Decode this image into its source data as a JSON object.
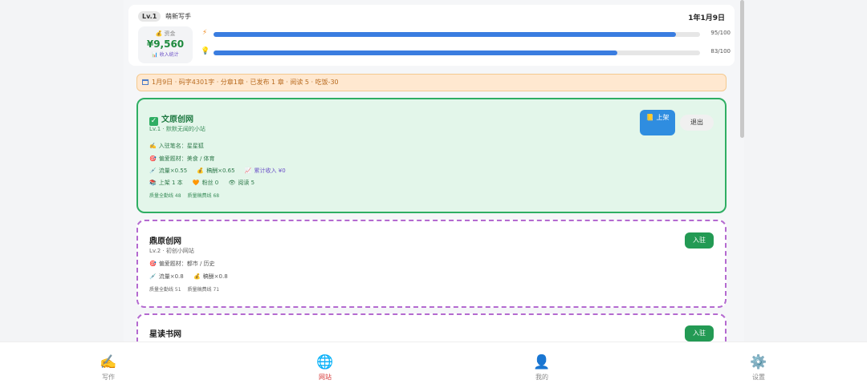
{
  "header": {
    "level_badge": "Lv.1",
    "title": "萌新写手",
    "date": "1年1月9日",
    "money": {
      "label": "💰 资金",
      "value": "¥9,560",
      "stats_link": "📊 收入统计"
    },
    "energy": {
      "icon": "⚡",
      "value_text": "95/100",
      "percent": 95
    },
    "inspiration": {
      "icon": "💡",
      "value_text": "83/100",
      "percent": 83
    }
  },
  "notice": {
    "text": "1月9日 · 码字4301字 · 分章1章 · 已发布 1 章 · 阅读 5 · 吃饭-30"
  },
  "sites": [
    {
      "name": "文原创网",
      "subtitle": "Lv.1 · 默默无闻的小站",
      "pen_name": "入驻笔名：星星狐",
      "topics": "偏爱题材：美食 / 体育",
      "traffic": "流量×0.55",
      "fee": "稿酬×0.65",
      "income": "累计收入 ¥0",
      "shelved": "上架 1 本",
      "fans": "粉丝 0",
      "reads": "阅读 5",
      "quality_full": "质量全勤线 48",
      "quality_fee": "质量稿费线 68",
      "shelf_button": "上架",
      "exit_button": "退出"
    },
    {
      "name": "鼎原创网",
      "subtitle": "Lv.2 · 初创小网站",
      "topics": "偏爱题材：都市 / 历史",
      "traffic": "流量×0.8",
      "fee": "稿酬×0.8",
      "quality_full": "质量全勤线 51",
      "quality_fee": "质量稿费线 71",
      "join_button": "入驻"
    },
    {
      "name": "星读书网",
      "join_button": "入驻"
    }
  ],
  "nav": [
    {
      "icon": "✍️",
      "label": "写作",
      "active": false
    },
    {
      "icon": "🌐",
      "label": "网站",
      "active": true
    },
    {
      "icon": "👤",
      "label": "我的",
      "active": false
    },
    {
      "icon": "⚙️",
      "label": "设置",
      "active": false
    }
  ],
  "colors": {
    "accent_blue": "#3a7de0",
    "joined_green": "#2fae63",
    "available_purple": "#b46ad0",
    "active_nav_red": "#d63b3b"
  }
}
